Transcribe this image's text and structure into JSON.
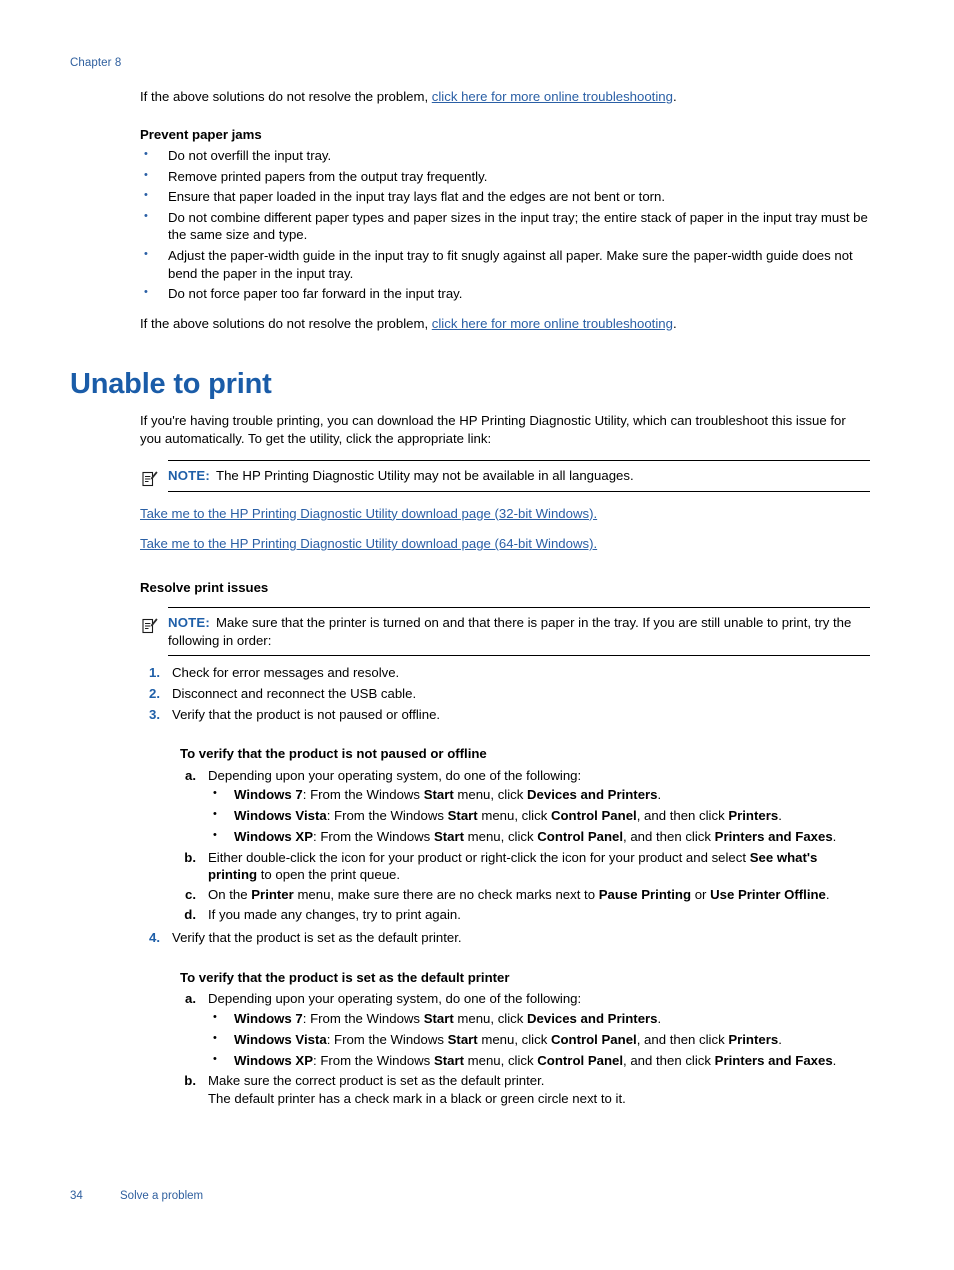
{
  "header": {
    "chapter": "Chapter 8"
  },
  "colors": {
    "heading_blue": "#1a5ca8",
    "link_blue": "#2a5fa5",
    "note_blue": "#1f5fa8",
    "bullet_blue": "#2a5fa5",
    "footer_blue": "#2f5f9e",
    "text_black": "#000000",
    "page_background": "#ffffff"
  },
  "intro": {
    "line_prefix": "If the above solutions do not resolve the problem, ",
    "link": "click here for more online troubleshooting",
    "line_suffix": "."
  },
  "prevent_paper_jams": {
    "title": "Prevent paper jams",
    "items": [
      "Do not overfill the input tray.",
      "Remove printed papers from the output tray frequently.",
      "Ensure that paper loaded in the input tray lays flat and the edges are not bent or torn.",
      "Do not combine different paper types and paper sizes in the input tray; the entire stack of paper in the input tray must be the same size and type.",
      "Adjust the paper-width guide in the input tray to fit snugly against all paper. Make sure the paper-width guide does not bend the paper in the input tray.",
      "Do not force paper too far forward in the input tray."
    ]
  },
  "closing": {
    "line_prefix": "If the above solutions do not resolve the problem, ",
    "link": "click here for more online troubleshooting",
    "line_suffix": "."
  },
  "section": {
    "title": "Unable to print",
    "intro": "If you're having trouble printing, you can download the HP Printing Diagnostic Utility, which can troubleshoot this issue for you automatically. To get the utility, click the appropriate link:"
  },
  "note_one": {
    "icon": "note-pencil-icon",
    "label": "NOTE:",
    "text": "The HP Printing Diagnostic Utility may not be available in all languages."
  },
  "download_links": [
    "Take me to the HP Printing Diagnostic Utility download page (32-bit Windows).",
    "Take me to the HP Printing Diagnostic Utility download page (64-bit Windows)."
  ],
  "resolve": {
    "title": "Resolve print issues"
  },
  "note_two": {
    "icon": "note-pencil-icon",
    "label": "NOTE:",
    "text": "Make sure that the printer is turned on and that there is paper in the tray. If you are still unable to print, try the following in order:"
  },
  "steps": [
    {
      "num": "1.",
      "text": "Check for error messages and resolve."
    },
    {
      "num": "2.",
      "text": "Disconnect and reconnect the USB cable."
    },
    {
      "num": "3.",
      "text": "Verify that the product is not paused or offline."
    },
    {
      "num": "4.",
      "text": "Verify that the product is set as the default printer."
    }
  ],
  "proc_paused": {
    "title": "To verify that the product is not paused or offline",
    "a": {
      "alpha": "a",
      "dot": ".",
      "text": "Depending upon your operating system, do one of the following:",
      "bullets": [
        {
          "os": "Windows 7",
          "t1": ": From the Windows ",
          "b1": "Start",
          "t2": " menu, click ",
          "b2": "Devices and Printers",
          "t3": ".",
          "b3": "",
          "t4": ""
        },
        {
          "os": "Windows Vista",
          "t1": ": From the Windows ",
          "b1": "Start",
          "t2": " menu, click ",
          "b2": "Control Panel",
          "t3": ", and then click ",
          "b3": "Printers",
          "t4": "."
        },
        {
          "os": "Windows XP",
          "t1": ": From the Windows ",
          "b1": "Start",
          "t2": " menu, click ",
          "b2": "Control Panel",
          "t3": ", and then click ",
          "b3": "Printers and Faxes",
          "t4": "."
        }
      ]
    },
    "b": {
      "alpha": "b",
      "dot": ".",
      "t1": "Either double-click the icon for your product or right-click the icon for your product and select ",
      "b1": "See what's printing",
      "t2": " to open the print queue."
    },
    "c": {
      "alpha": "c",
      "dot": ".",
      "t1": "On the ",
      "b1": "Printer",
      "t2": " menu, make sure there are no check marks next to ",
      "b2": "Pause Printing",
      "t3": " or ",
      "b3": "Use Printer Offline",
      "t4": "."
    },
    "d": {
      "alpha": "d",
      "dot": ".",
      "text": "If you made any changes, try to print again."
    }
  },
  "proc_default": {
    "title": "To verify that the product is set as the default printer",
    "a": {
      "alpha": "a",
      "dot": ".",
      "text": "Depending upon your operating system, do one of the following:",
      "bullets": [
        {
          "os": "Windows 7",
          "t1": ": From the Windows ",
          "b1": "Start",
          "t2": " menu, click ",
          "b2": "Devices and Printers",
          "t3": ".",
          "b3": "",
          "t4": ""
        },
        {
          "os": "Windows Vista",
          "t1": ": From the Windows ",
          "b1": "Start",
          "t2": " menu, click ",
          "b2": "Control Panel",
          "t3": ", and then click ",
          "b3": "Printers",
          "t4": "."
        },
        {
          "os": "Windows XP",
          "t1": ": From the Windows ",
          "b1": "Start",
          "t2": " menu, click ",
          "b2": "Control Panel",
          "t3": ", and then click ",
          "b3": "Printers and Faxes",
          "t4": "."
        }
      ]
    },
    "b": {
      "alpha": "b",
      "dot": ".",
      "text": "Make sure the correct product is set as the default printer.",
      "text2": "The default printer has a check mark in a black or green circle next to it."
    }
  },
  "footer": {
    "page_number": "34",
    "text": "Solve a problem"
  }
}
